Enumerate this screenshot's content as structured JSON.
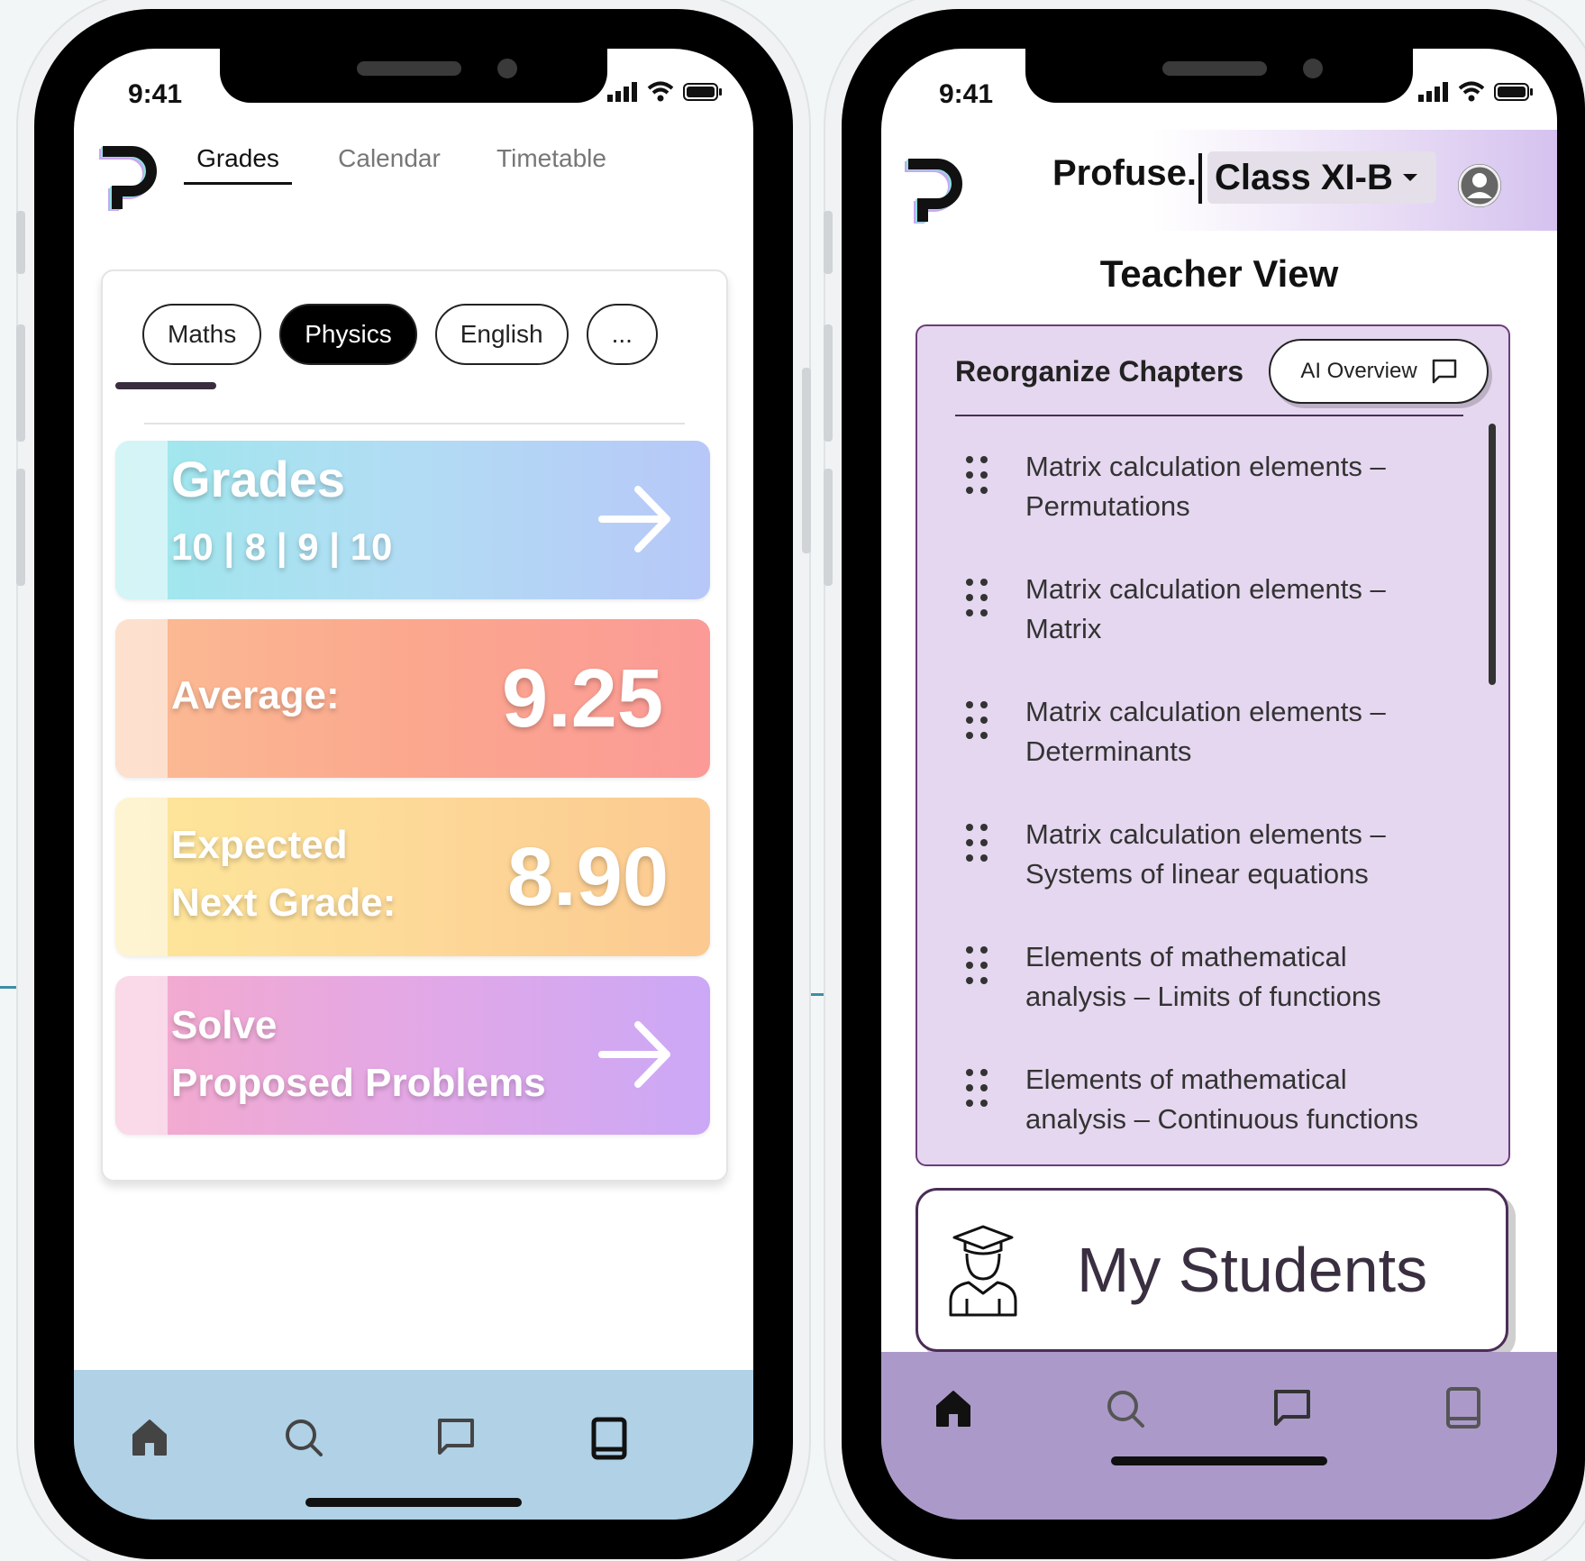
{
  "left_phone": {
    "status": {
      "time": "9:41"
    },
    "nav_tabs": [
      {
        "label": "Grades",
        "active": true
      },
      {
        "label": "Calendar",
        "active": false
      },
      {
        "label": "Timetable",
        "active": false
      }
    ],
    "subject_chips": [
      {
        "label": "Maths",
        "active": false
      },
      {
        "label": "Physics",
        "active": true
      },
      {
        "label": "English",
        "active": false
      },
      {
        "label": "...",
        "active": false
      }
    ],
    "cards": {
      "grades": {
        "title": "Grades",
        "values": "10 | 8 | 9 | 10"
      },
      "average": {
        "label": "Average:",
        "value": "9.25"
      },
      "expected": {
        "label_line1": "Expected",
        "label_line2": "Next Grade:",
        "value": "8.90"
      },
      "solve": {
        "line1": "Solve",
        "line2": "Proposed Problems"
      }
    },
    "bottom_nav": [
      "home-icon",
      "search-icon",
      "chat-icon",
      "book-icon"
    ],
    "colors": {
      "bottom_bar": "#b0d1e6"
    }
  },
  "right_phone": {
    "status": {
      "time": "9:41"
    },
    "header": {
      "brand": "Profuse.",
      "class_selector": "Class XI-B"
    },
    "view_title": "Teacher View",
    "chapters_panel": {
      "title": "Reorganize Chapters",
      "ai_button": "AI Overview",
      "items": [
        {
          "line1": "Matrix calculation elements –",
          "line2": "Permutations"
        },
        {
          "line1": "Matrix calculation elements –",
          "line2": "Matrix"
        },
        {
          "line1": "Matrix calculation elements –",
          "line2": "Determinants"
        },
        {
          "line1": "Matrix calculation elements –",
          "line2": "Systems of linear equations"
        },
        {
          "line1": "Elements of mathematical",
          "line2": "analysis – Limits of functions"
        },
        {
          "line1": "Elements of mathematical",
          "line2": "analysis – Continuous functions"
        }
      ]
    },
    "students_button": "My Students",
    "bottom_nav": [
      "home-icon",
      "search-icon",
      "chat-icon",
      "book-icon"
    ],
    "colors": {
      "panel": "#e5d7ef",
      "bottom_bar": "#ab9ac9"
    }
  }
}
